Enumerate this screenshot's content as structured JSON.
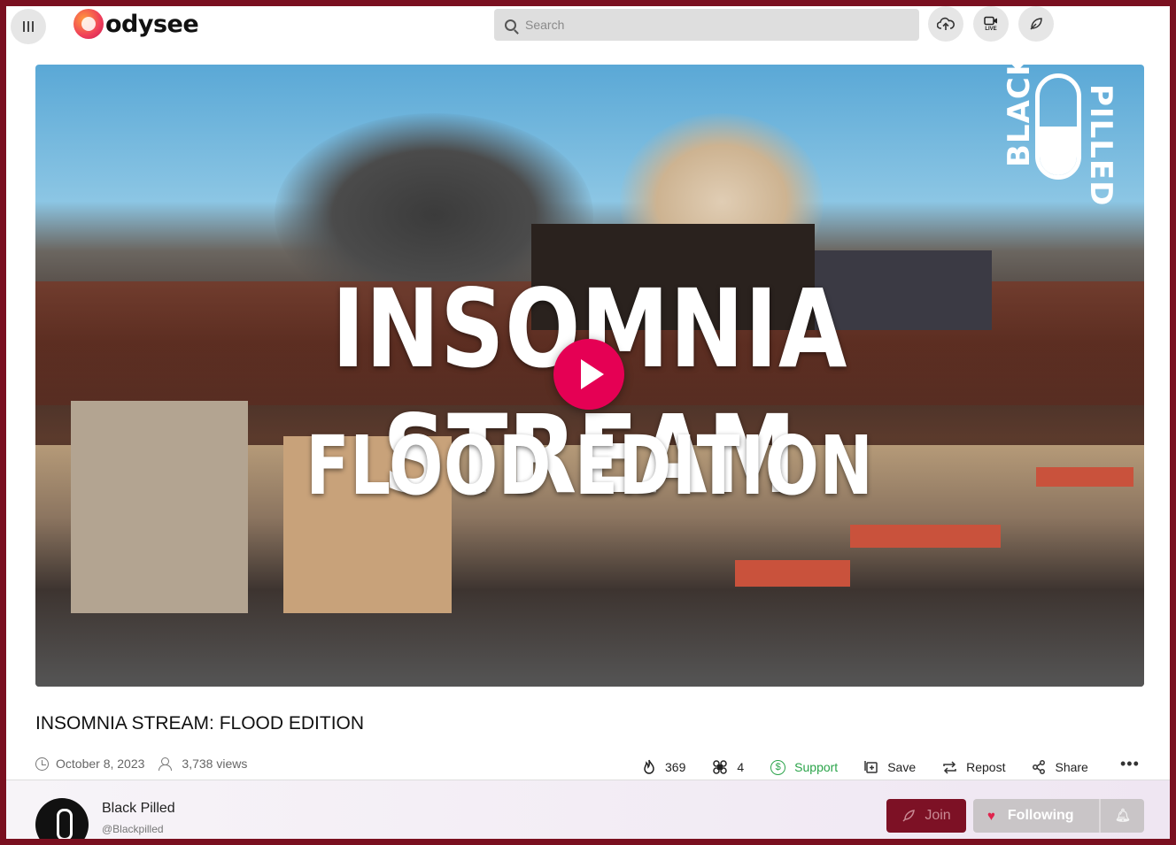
{
  "header": {
    "logo_text": "odysee",
    "search_placeholder": "Search",
    "live_label": "LIVE",
    "icons": [
      "menu-icon",
      "upload-icon",
      "live-icon",
      "publish-icon"
    ]
  },
  "video": {
    "thumbnail_title_line1": "INSOMNIA STREAM",
    "thumbnail_title_line2": "FLOOD EDITION",
    "watermark_left": "BLACK",
    "watermark_right": "PILLED",
    "play_color": "#e50054"
  },
  "details": {
    "title": "INSOMNIA STREAM: FLOOD EDITION",
    "date": "October 8, 2023",
    "views": "3,738 views",
    "fire_count": "369",
    "slime_count": "4",
    "support_label": "Support",
    "save_label": "Save",
    "repost_label": "Repost",
    "share_label": "Share",
    "more_label": "•••"
  },
  "channel": {
    "name": "Black Pilled",
    "handle": "@Blackpilled",
    "join_label": "Join",
    "following_label": "Following"
  },
  "colors": {
    "frame": "#7a1020",
    "accent": "#e50054",
    "support_green": "#2ba44a",
    "join_bg": "#7d1125"
  }
}
